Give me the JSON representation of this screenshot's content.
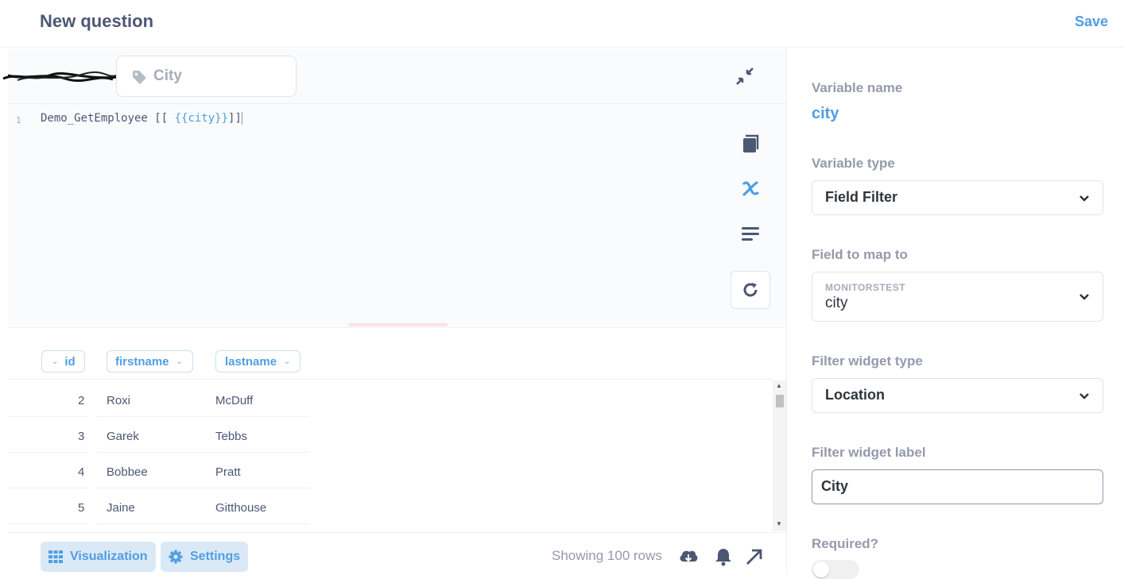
{
  "header": {
    "title": "New question",
    "save_label": "Save"
  },
  "editor": {
    "param_widget_label": "City",
    "line_number": "1",
    "code_prefix": "Demo_GetEmployee ",
    "code_open": "[[ ",
    "code_var": "{{city}}",
    "code_close": "]]"
  },
  "results": {
    "columns": [
      "id",
      "firstname",
      "lastname"
    ],
    "rows": [
      [
        "2",
        "Roxi",
        "McDuff"
      ],
      [
        "3",
        "Garek",
        "Tebbs"
      ],
      [
        "4",
        "Bobbee",
        "Pratt"
      ],
      [
        "5",
        "Jaine",
        "Gitthouse"
      ]
    ]
  },
  "footer": {
    "visualization_label": "Visualization",
    "settings_label": "Settings",
    "row_count": "Showing 100 rows"
  },
  "sidebar": {
    "variable_name_label": "Variable name",
    "variable_name": "city",
    "variable_type_label": "Variable type",
    "variable_type": "Field Filter",
    "field_map_label": "Field to map to",
    "field_map_db": "MONITORSTEST",
    "field_map_value": "city",
    "widget_type_label": "Filter widget type",
    "widget_type": "Location",
    "widget_label_label": "Filter widget label",
    "widget_label_value": "City",
    "required_label": "Required?"
  },
  "colors": {
    "accent": "#509ee3",
    "text": "#4c5773",
    "muted": "#949aab"
  },
  "icons": [
    "tag-icon",
    "collapse-icon",
    "book-icon",
    "variable-x-icon",
    "format-icon",
    "refresh-icon",
    "table-icon",
    "gear-icon",
    "download-icon",
    "bell-icon",
    "arrow-up-right-icon",
    "chevron-down-icon"
  ]
}
